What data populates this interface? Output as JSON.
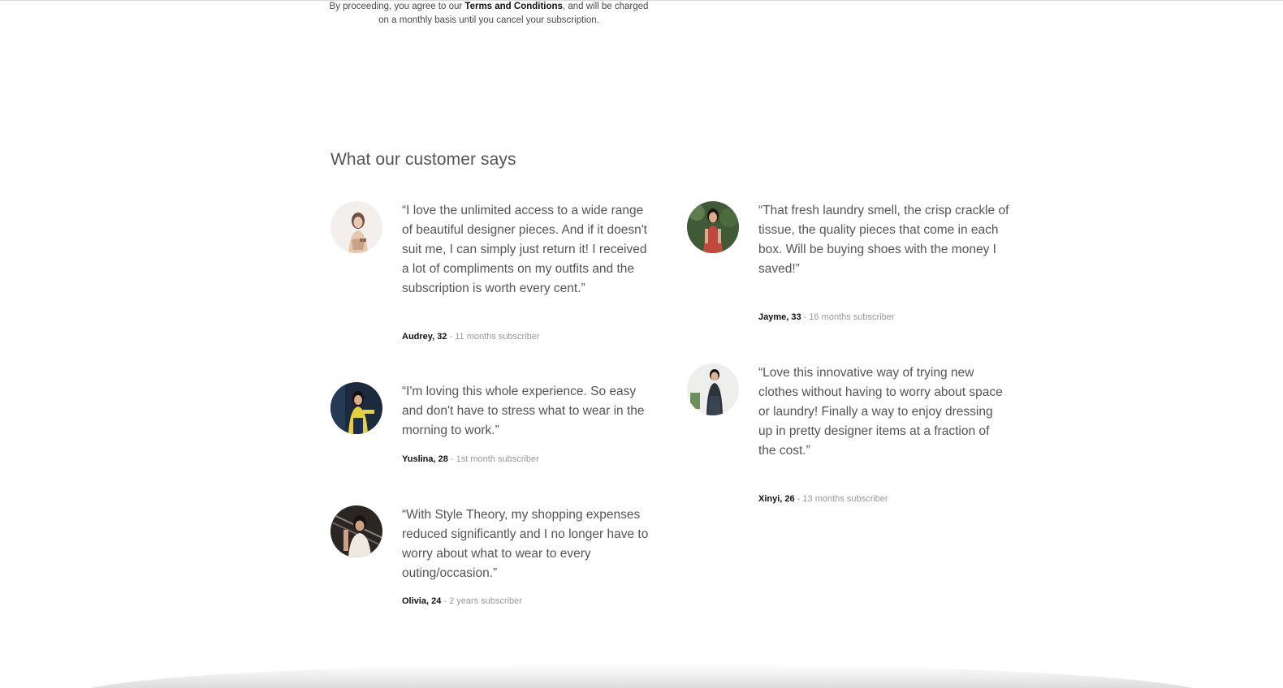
{
  "terms": {
    "prefix": "By proceeding, you agree to our ",
    "link": "Terms and Conditions",
    "suffix": ", and will be charged on a monthly basis until you cancel your subscription."
  },
  "section": {
    "title": "What our customer says"
  },
  "testimonials": [
    {
      "quote": "“I love the unlimited access to a wide range of beautiful designer pieces. And if it doesn't suit me, I can simply just return it! I received a lot of compliments on my outfits and the subscription is worth every cent.”",
      "name": "Audrey, 32",
      "tenure": " - 11 months subscriber"
    },
    {
      "quote": "“That fresh laundry smell, the crisp crackle of tissue, the quality pieces that come in each box. Will be buying shoes with the money I saved!”",
      "name": "Jayme, 33",
      "tenure": " - 16 months subscriber"
    },
    {
      "quote": "“I'm loving this whole experience. So easy and don't have to stress what to wear in the morning to work.”",
      "name": "Yuslina, 28",
      "tenure": " - 1st month subscriber"
    },
    {
      "quote": "“Love this innovative way of trying new clothes without having to worry about space or laundry! Finally a way to enjoy dressing up in pretty designer items at a fraction of the cost.”",
      "name": "Xinyi, 26",
      "tenure": " - 13 months subscriber"
    },
    {
      "quote": "“With Style Theory, my shopping expenses reduced significantly and I no longer have to worry about what to wear to every outing/occasion.”",
      "name": "Olivia, 24",
      "tenure": " - 2 years subscriber"
    }
  ],
  "colors": {
    "heading": "#555555",
    "body": "#555555",
    "name": "#111111",
    "tenure": "#999999"
  }
}
